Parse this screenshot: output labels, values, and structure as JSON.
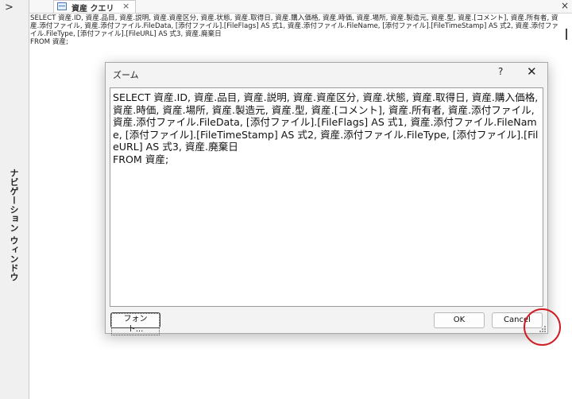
{
  "nav": {
    "toggle": ">",
    "label": "ナビゲーション ウィンドウ"
  },
  "tab": {
    "label": "資産 クエリ",
    "close": "×"
  },
  "window": {
    "close": "×"
  },
  "background_sql": "SELECT 資産.ID, 資産.品目, 資産.説明, 資産.資産区分, 資産.状態, 資産.取得日, 資産.購入価格, 資産.時価, 資産.場所, 資産.製造元, 資産.型, 資産.[コメント], 資産.所有者, 資産.添付ファイル, 資産.添付ファイル.FileData, [添付ファイル].[FileFlags] AS 式1, 資産.添付ファイル.FileName, [添付ファイル].[FileTimeStamp] AS 式2, 資産.添付ファイル.FileType, [添付ファイル].[FileURL] AS 式3, 資産.廃棄日\nFROM 資産;",
  "dialog": {
    "title": "ズーム",
    "help": "?",
    "close": "✕",
    "text": "SELECT 資産.ID, 資産.品目, 資産.説明, 資産.資産区分, 資産.状態, 資産.取得日, 資産.購入価格, 資産.時価, 資産.場所, 資産.製造元, 資産.型, 資産.[コメント], 資産.所有者, 資産.添付ファイル, 資産.添付ファイル.FileData, [添付ファイル].[FileFlags] AS 式1, 資産.添付ファイル.FileName, [添付ファイル].[FileTimeStamp] AS 式2, 資産.添付ファイル.FileType, [添付ファイル].[FileURL] AS 式3, 資産.廃棄日\nFROM 資産;",
    "font_button": "フォント...",
    "ok_button": "OK",
    "cancel_button": "Cancel"
  },
  "colors": {
    "highlight_circle": "#d01c24"
  }
}
